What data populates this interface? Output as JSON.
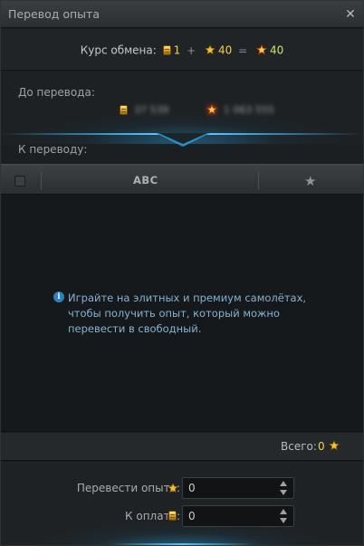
{
  "window": {
    "title": "Перевод опыта",
    "close_glyph": "✕"
  },
  "rate": {
    "label": "Курс обмена:",
    "gold_amount": "1",
    "plus": "+",
    "xp_amount": "40",
    "equals": "=",
    "free_xp_amount": "40",
    "icons": [
      "gold-coin-icon",
      "xp-star-icon",
      "free-xp-star-icon"
    ]
  },
  "before": {
    "label": "До перевода:",
    "gold_value": "37 539",
    "free_xp_value": "1 063 555"
  },
  "to_transfer": {
    "label": "К переводу:"
  },
  "table": {
    "header_name": "ABC",
    "header_star": "★"
  },
  "list": {
    "info_glyph": "i",
    "empty_message": "Играйте на элитных и премиум самолётах, чтобы получить опыт, который можно перевести в свободный."
  },
  "total": {
    "label": "Всего:",
    "value": "0"
  },
  "form": {
    "transfer_label": "Перевести опыта:",
    "transfer_value": "0",
    "pay_label": "К оплате:",
    "pay_value": "0"
  },
  "colors": {
    "accent_blue": "#3fb0e8",
    "gold": "#f2d14a",
    "free_xp_green": "#cde56a",
    "info_text": "#86b1d1"
  }
}
